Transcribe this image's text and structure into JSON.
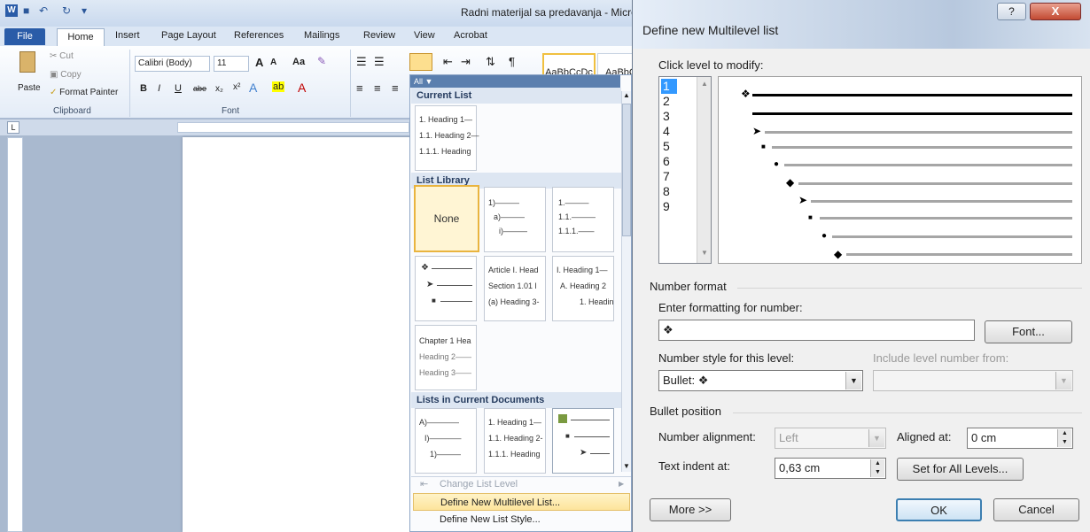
{
  "word": {
    "window_title": "Radni materijal sa predavanja - Microso",
    "tabs": [
      "File",
      "Home",
      "Insert",
      "Page Layout",
      "References",
      "Mailings",
      "Review",
      "View",
      "Acrobat"
    ],
    "clipboard": {
      "paste": "Paste",
      "cut": "Cut",
      "copy": "Copy",
      "format_painter": "Format Painter",
      "group": "Clipboard"
    },
    "font": {
      "name": "Calibri (Body)",
      "size": "11",
      "group": "Font",
      "grow": "A",
      "shrink": "A",
      "change_case": "Aa",
      "clear": "A"
    },
    "styles": {
      "style1": "AaBbCcDc",
      "style2": "AaBbC"
    },
    "gallery": {
      "filter": "All ▼",
      "current_list": "Current List",
      "current_item": [
        "1. Heading 1—",
        "1.1. Heading 2—",
        "1.1.1. Heading"
      ],
      "list_library": "List Library",
      "none": "None",
      "lib1": [
        "1)———",
        "a)———",
        "i)———"
      ],
      "lib2": [
        "1.———",
        "1.1.———",
        "1.1.1.——"
      ],
      "lib4": [
        "Article I. Head",
        "Section 1.01 l",
        "(a) Heading 3-"
      ],
      "lib5": [
        "I. Heading 1—",
        "A. Heading 2",
        "1. Headin"
      ],
      "lib6": [
        "Chapter 1 Hea",
        "Heading 2——",
        "Heading 3——"
      ],
      "lists_in_doc": "Lists in Current Documents",
      "doc1": [
        "A)————",
        "I)————",
        "1)———"
      ],
      "doc2": [
        "1. Heading 1—",
        "1.1. Heading 2-",
        "1.1.1. Heading"
      ],
      "change_level": "Change List Level",
      "define_new": "Define New Multilevel List...",
      "define_style": "Define New List Style..."
    }
  },
  "dialog": {
    "title": "Define new Multilevel list",
    "help": "?",
    "close": "X",
    "click_level": "Click level to modify:",
    "levels": [
      "1",
      "2",
      "3",
      "4",
      "5",
      "6",
      "7",
      "8",
      "9"
    ],
    "number_format": "Number format",
    "enter_formatting": "Enter formatting for number:",
    "format_value": "❖",
    "font_button": "Font...",
    "number_style_label": "Number style for this level:",
    "number_style_value": "Bullet: ❖",
    "include_level_label": "Include level number from:",
    "bullet_position": "Bullet position",
    "number_alignment_label": "Number alignment:",
    "number_alignment_value": "Left",
    "aligned_at_label": "Aligned at:",
    "aligned_at_value": "0 cm",
    "text_indent_label": "Text indent at:",
    "text_indent_value": "0,63 cm",
    "set_all_button": "Set for All Levels...",
    "more_button": "More >>",
    "ok_button": "OK",
    "cancel_button": "Cancel"
  }
}
